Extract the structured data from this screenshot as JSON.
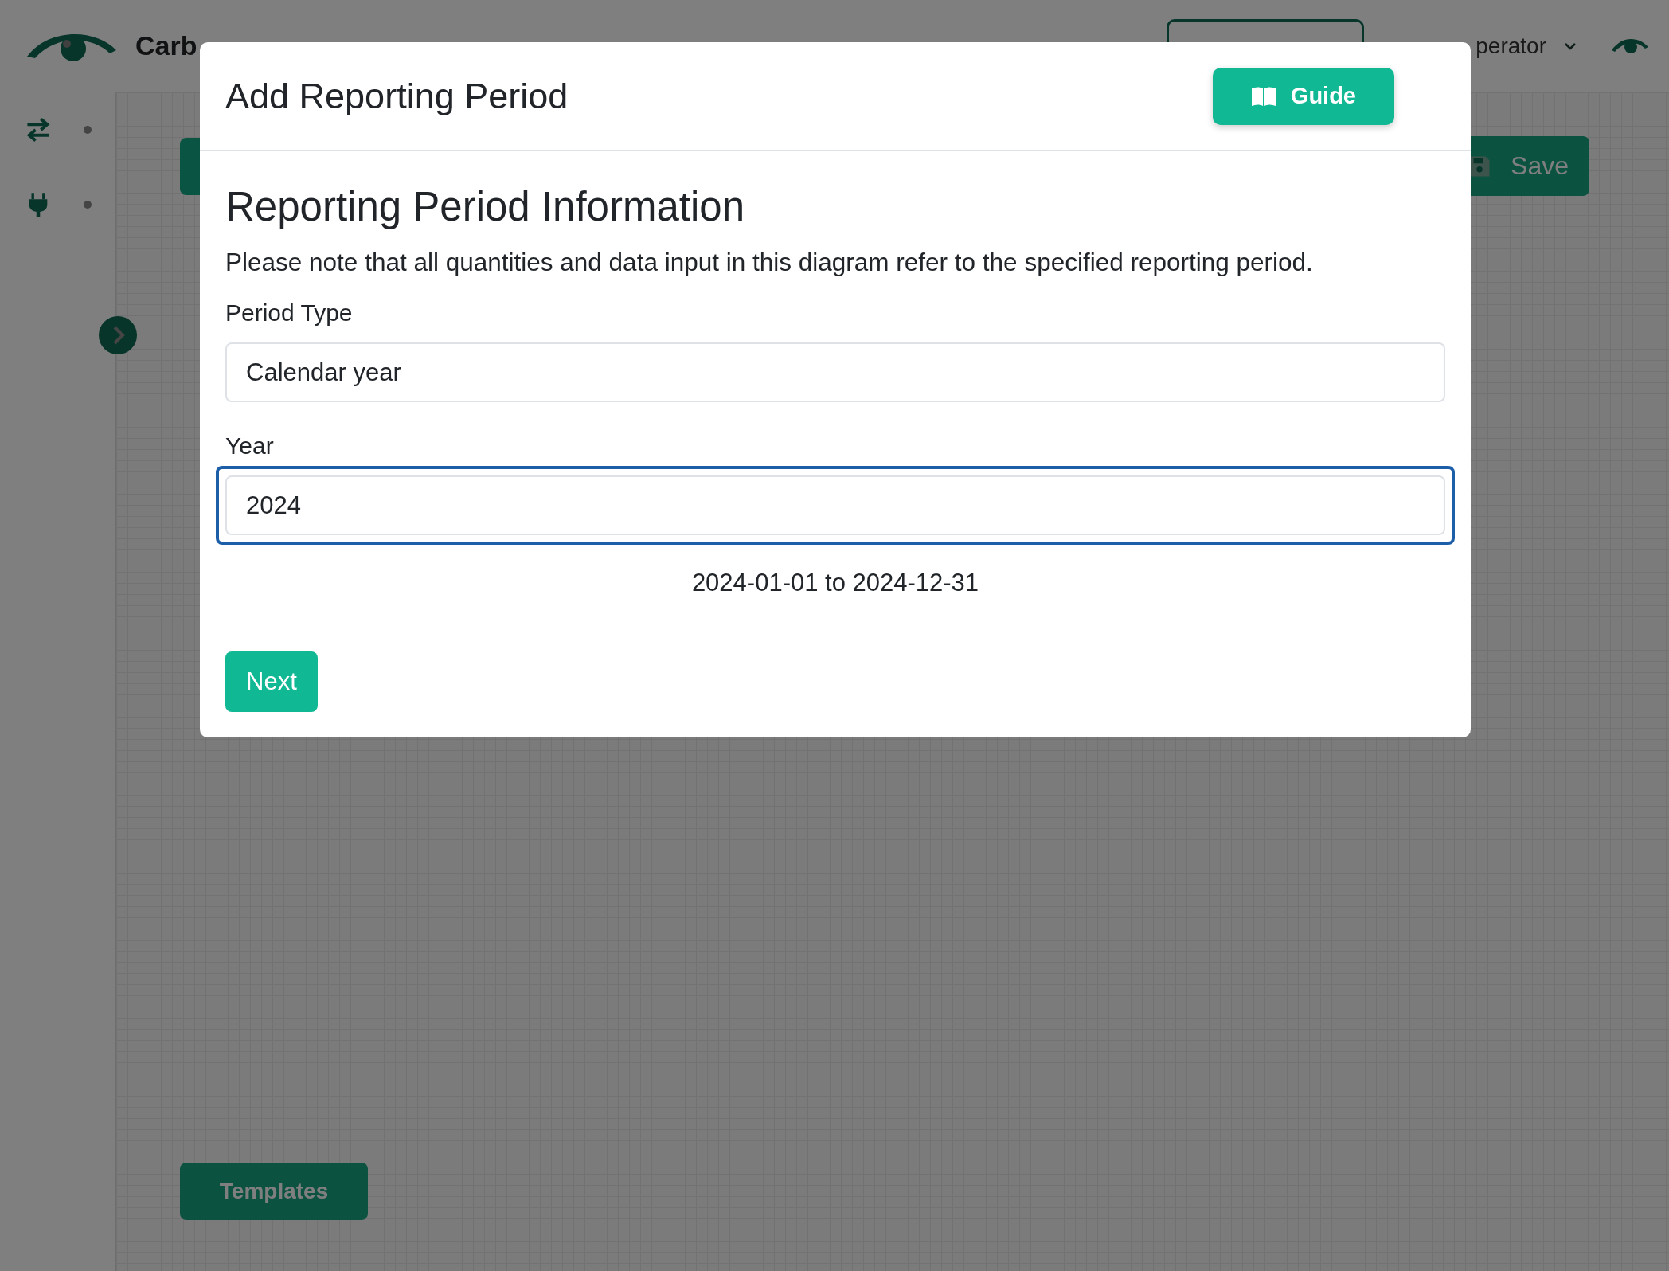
{
  "app_header": {
    "brand": "Carb",
    "user_menu": "perator"
  },
  "canvas": {
    "save_button": "Save",
    "templates_button": "Templates"
  },
  "modal": {
    "title": "Add Reporting Period",
    "guide_button": "Guide",
    "heading": "Reporting Period Information",
    "note": "Please note that all quantities and data input in this diagram refer to the specified reporting period.",
    "fields": [
      {
        "label": "Period Type",
        "value": "Calendar year",
        "focused": false
      },
      {
        "label": "Year",
        "value": "2024",
        "focused": true
      }
    ],
    "range": "2024-01-01 to 2024-12-31",
    "next_button": "Next"
  }
}
